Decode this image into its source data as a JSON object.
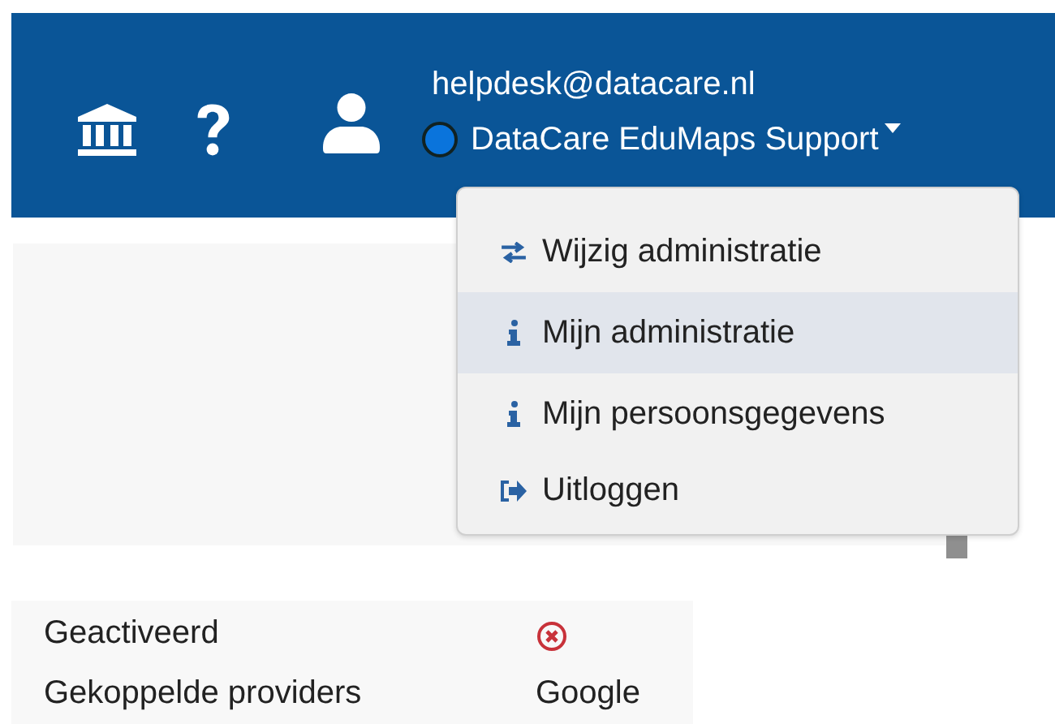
{
  "header": {
    "email": "helpdesk@datacare.nl",
    "organization": "DataCare EduMaps Support"
  },
  "menu": {
    "items": [
      {
        "kind": "switch",
        "label": "Wijzig administratie",
        "selected": false
      },
      {
        "kind": "info",
        "label": "Mijn administratie",
        "selected": true
      },
      {
        "kind": "info",
        "label": "Mijn persoonsgegevens",
        "selected": false
      },
      {
        "kind": "logout",
        "label": "Uitloggen",
        "selected": false
      }
    ]
  },
  "details": [
    {
      "kind": "status",
      "label": "Geactiveerd",
      "activated": false
    },
    {
      "kind": "text",
      "label": "Gekoppelde providers",
      "value": "Google"
    }
  ]
}
